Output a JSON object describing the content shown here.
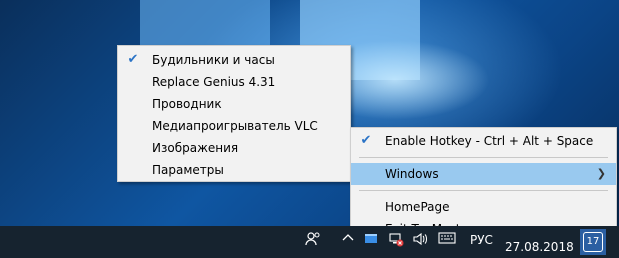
{
  "menu_primary": {
    "items": [
      {
        "label": "Будильники и часы",
        "checked": true
      },
      {
        "label": "Replace Genius 4.31",
        "checked": false
      },
      {
        "label": "Проводник",
        "checked": false
      },
      {
        "label": "Медиапроигрыватель VLC",
        "checked": false
      },
      {
        "label": "Изображения",
        "checked": false
      },
      {
        "label": "Параметры",
        "checked": false
      }
    ]
  },
  "menu_tray": {
    "enable_hotkey": "Enable Hotkey - Ctrl + Alt + Space",
    "windows": "Windows",
    "homepage": "HomePage",
    "exit": "Exit TopMost.exe"
  },
  "taskbar": {
    "language": "РУС",
    "date": "27.08.2018",
    "notification_count": "17",
    "icons": [
      "people-icon",
      "chevron-up-icon",
      "network-disconnected-icon",
      "volume-icon",
      "keyboard-icon",
      "action-center-icon"
    ]
  }
}
